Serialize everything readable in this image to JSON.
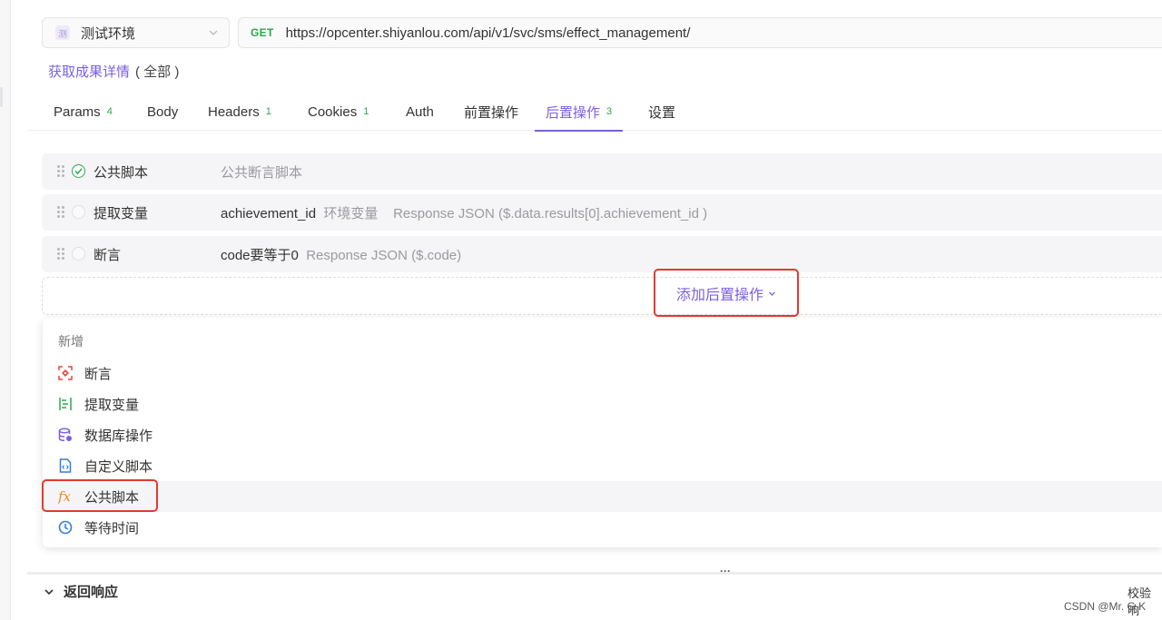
{
  "environment": {
    "badge": "测",
    "name": "测试环境"
  },
  "request": {
    "method": "GET",
    "url": "https://opcenter.shiyanlou.com/api/v1/svc/sms/effect_management/"
  },
  "api": {
    "name": "获取成果详情",
    "scope": "( 全部 )"
  },
  "tabs": [
    {
      "label": "Params",
      "count": "4"
    },
    {
      "label": "Body",
      "count": ""
    },
    {
      "label": "Headers",
      "count": "1"
    },
    {
      "label": "Cookies",
      "count": "1"
    },
    {
      "label": "Auth",
      "count": ""
    },
    {
      "label": "前置操作",
      "count": ""
    },
    {
      "label": "后置操作",
      "count": "3",
      "active": true
    },
    {
      "label": "设置",
      "count": ""
    }
  ],
  "processors": [
    {
      "name": "公共脚本",
      "desc_main": "",
      "desc_muted": "公共断言脚本",
      "enabled": true
    },
    {
      "name": "提取变量",
      "desc_main": "achievement_id",
      "desc_muted": "环境变量    Response JSON ($.data.results[0].achievement_id )",
      "enabled": false
    },
    {
      "name": "断言",
      "desc_main": "code要等于0",
      "desc_muted": "Response JSON ($.code)",
      "enabled": false
    }
  ],
  "add_button": {
    "label": "添加后置操作"
  },
  "dropdown": {
    "group_label": "新增",
    "items": [
      {
        "label": "断言",
        "icon": "assertion-icon",
        "color": "#e5483e"
      },
      {
        "label": "提取变量",
        "icon": "extract-variable-icon",
        "color": "#2aa84a"
      },
      {
        "label": "数据库操作",
        "icon": "database-icon",
        "color": "#7b5fe0"
      },
      {
        "label": "自定义脚本",
        "icon": "script-file-icon",
        "color": "#2f7fe0"
      },
      {
        "label": "公共脚本",
        "icon": "fx-icon",
        "color": "#f08a1c"
      },
      {
        "label": "等待时间",
        "icon": "clock-icon",
        "color": "#2f7fe0"
      }
    ]
  },
  "bottom": {
    "resize_handle": "···",
    "response_label": "返回响应",
    "verify_label": "校验响"
  },
  "watermark": "CSDN @Mr. G K",
  "colors": {
    "accent": "#7b5fe0",
    "success": "#2aa84a",
    "highlight_border": "#e53a2f"
  }
}
